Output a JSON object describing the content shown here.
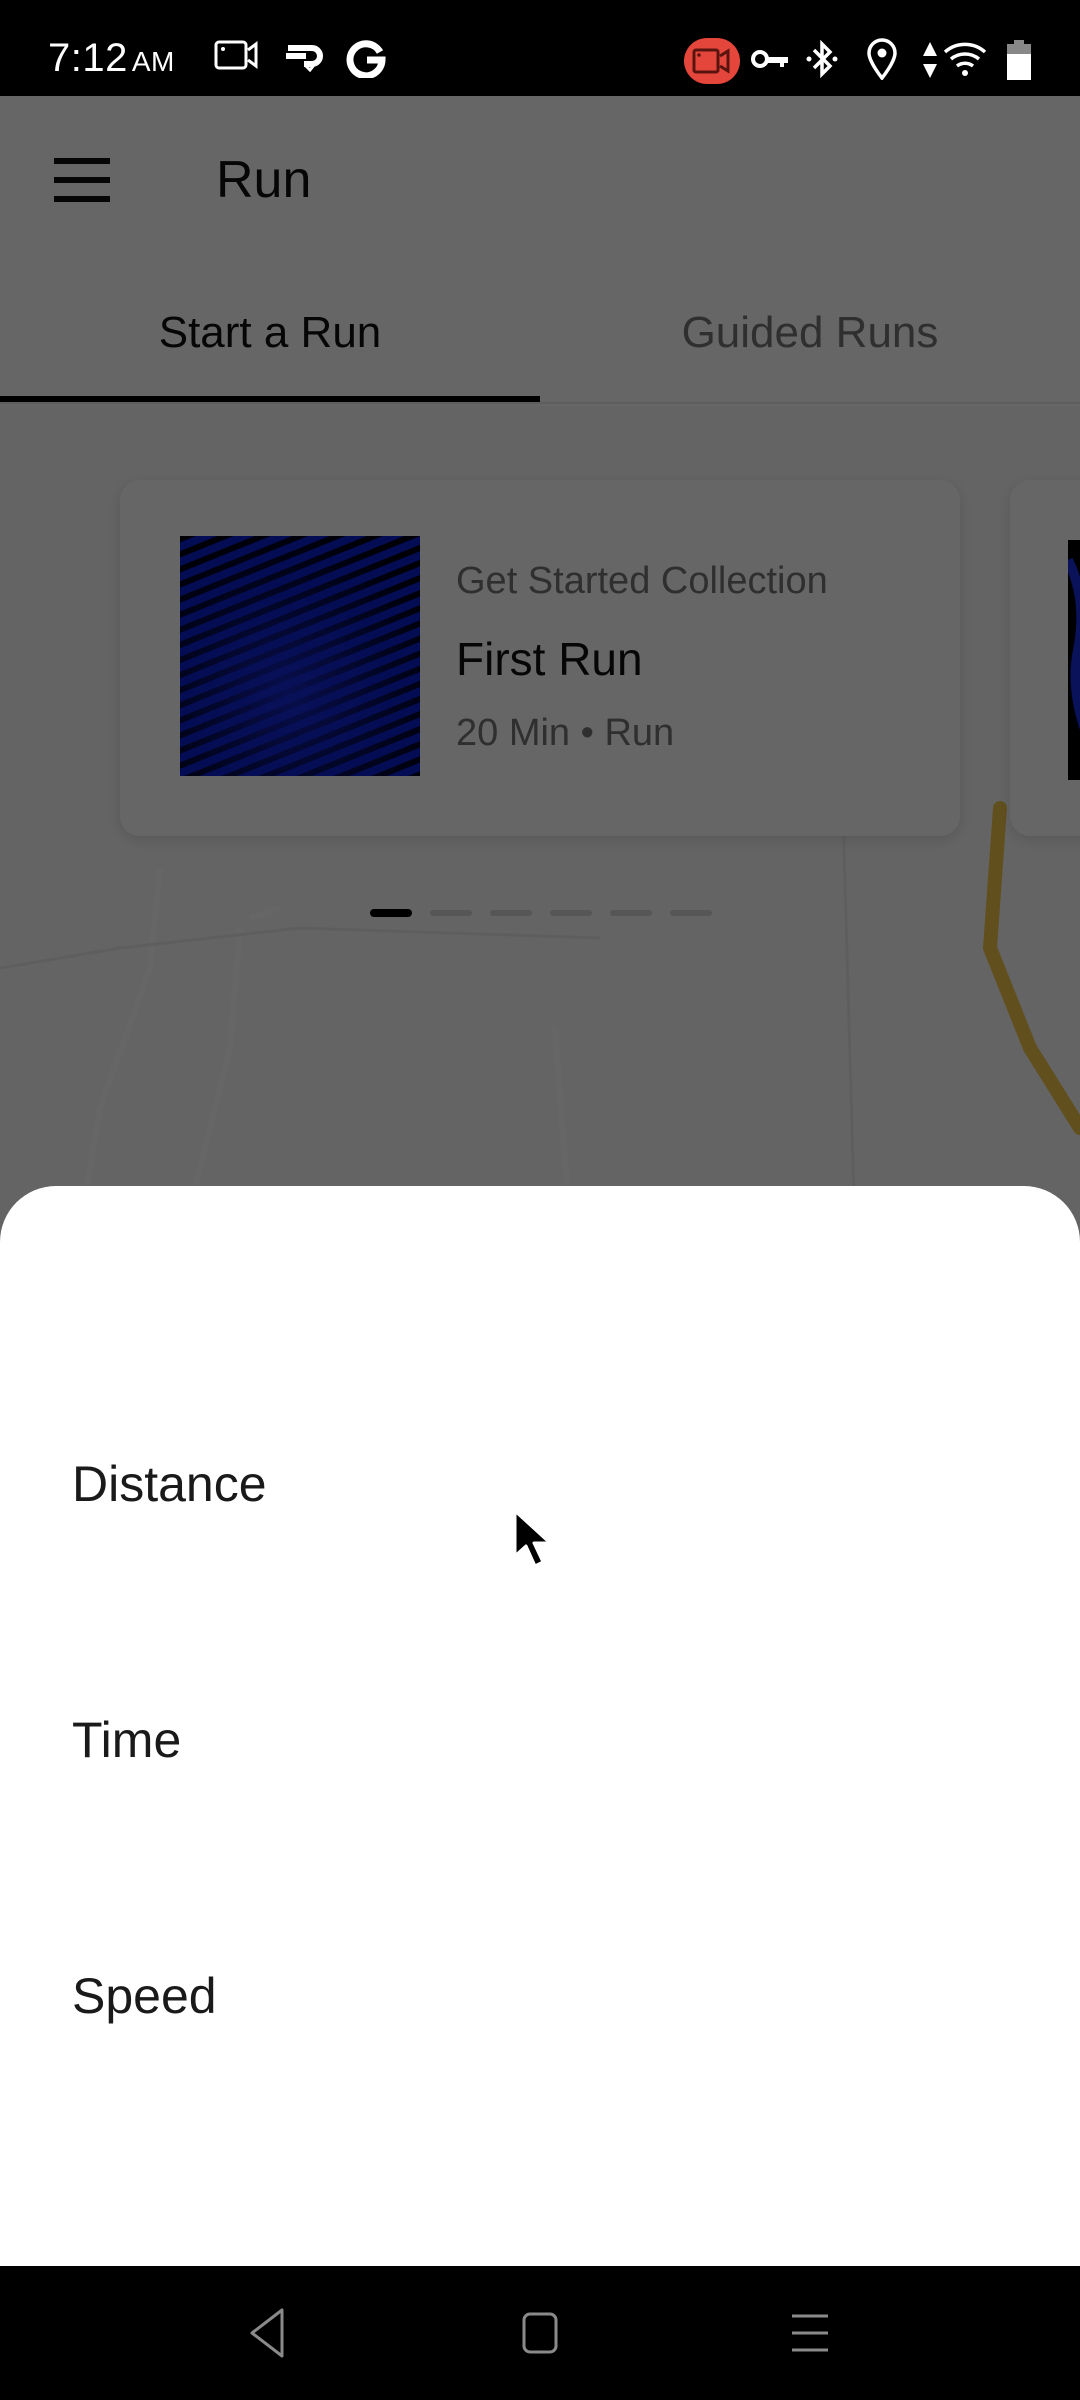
{
  "status_bar": {
    "time": "7:12",
    "ampm": "AM",
    "left_icons": [
      "screen-record-icon",
      "cloud-sync-icon",
      "google-icon"
    ],
    "right_icons": [
      "screen-record-active-icon",
      "vpn-key-icon",
      "bluetooth-icon",
      "location-icon",
      "data-arrows-icon",
      "wifi-icon",
      "battery-icon"
    ],
    "record_pill_color": "#e5463b"
  },
  "header": {
    "title": "Run",
    "menu_icon": "hamburger-menu-icon"
  },
  "tabs": [
    {
      "label": "Start a Run",
      "selected": true
    },
    {
      "label": "Guided Runs",
      "selected": false
    }
  ],
  "carousel": {
    "cards": [
      {
        "eyebrow": "Get Started Collection",
        "title": "First Run",
        "meta": "20 Min • Run",
        "art_color": "#0a1fd0"
      }
    ],
    "page_count": 6,
    "active_page": 1
  },
  "sheet": {
    "options": [
      {
        "label": "Distance"
      },
      {
        "label": "Time"
      },
      {
        "label": "Speed"
      }
    ]
  },
  "nav_bar": {
    "buttons": [
      "back-icon",
      "home-icon",
      "recents-icon"
    ]
  },
  "colors": {
    "accent": "#000000",
    "scrim": "rgba(0,0,0,0.60)",
    "route": "#f2c94c"
  }
}
